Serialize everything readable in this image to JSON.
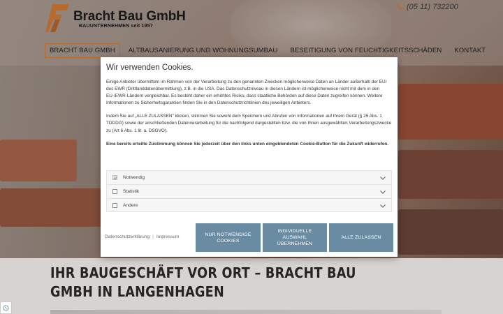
{
  "header": {
    "brand_name": "Bracht Bau GmbH",
    "brand_tagline": "BAUUNTERNEHMEN seit 1957",
    "phone": "(05 11) 732200"
  },
  "nav": {
    "items": [
      {
        "label": "BRACHT BAU GMBH"
      },
      {
        "label": "ALTBAUSANIERUNG UND WOHNUNGSUMBAU"
      },
      {
        "label": "BESEITIGUNG VON FEUCHTIGKEITSSCHÄDEN"
      },
      {
        "label": "KONTAKT"
      }
    ]
  },
  "cookie_modal": {
    "title": "Wir verwenden Cookies.",
    "paragraph_1": "Einige Anbieter übermitteln im Rahmen von der Verarbeitung zu den genannten Zwecken möglicherweise Daten an Länder außerhalb der EU/ des EWR (Drittlanddatenübermittlung), z.B. in die USA. Das Datenschutzniveau in diesen Ländern ist möglicherweise nicht mit dem in den EU-/EWR-Ländern vergleichbar. Es besteht daher ein erhöhtes Risiko, dass staatliche Behörden auf diese Daten zugreifen können. Weitere Informationen zu Sicherheitsgarantien finden Sie in den Datenschutzrichtlinien des jeweiligen Anbieters.",
    "paragraph_2": "Indem Sie auf „ALLE ZULASSEN\" klicken, stimmen Sie sowohl dem Speichern und Abrufen von Informationen auf Ihrem Gerät (§ 25 Abs. 1 TDDDG) sowie der anschließenden Datenverarbeitung für die nachfolgend dargestellten bzw. die von Ihnen ausgewählten Verarbeitungszwecke zu (Art 6 Abs. 1 lit. a. DSGVO).",
    "paragraph_3": "Eine bereits erteilte Zustimmung können Sie jederzeit über den links unten eingeblendeten Cookie-Button für die Zukunft widerrufen.",
    "categories": [
      {
        "label": "Notwendig",
        "checked": true
      },
      {
        "label": "Statistik",
        "checked": false
      },
      {
        "label": "Andere",
        "checked": false
      }
    ],
    "link_privacy": "Datenschutzerklärung",
    "link_separator": "|",
    "link_imprint": "Impressum",
    "btn_necessary": "NUR NOTWENDIGE COOKIES",
    "btn_individual": "INDIVIDUELLE AUSWAHL ÜBERNEHMEN",
    "btn_all": "ALLE ZULASSEN",
    "accent_color": "#6a8ca2"
  },
  "main": {
    "headline": "IHR BAUGESCHÄFT VOR ORT – BRACHT BAU GMBH IN LANGENHAGEN"
  },
  "icons": [
    "phone-icon",
    "chevron-down-icon",
    "checkbox-icon",
    "cookie-settings-icon",
    "logo-mark"
  ]
}
